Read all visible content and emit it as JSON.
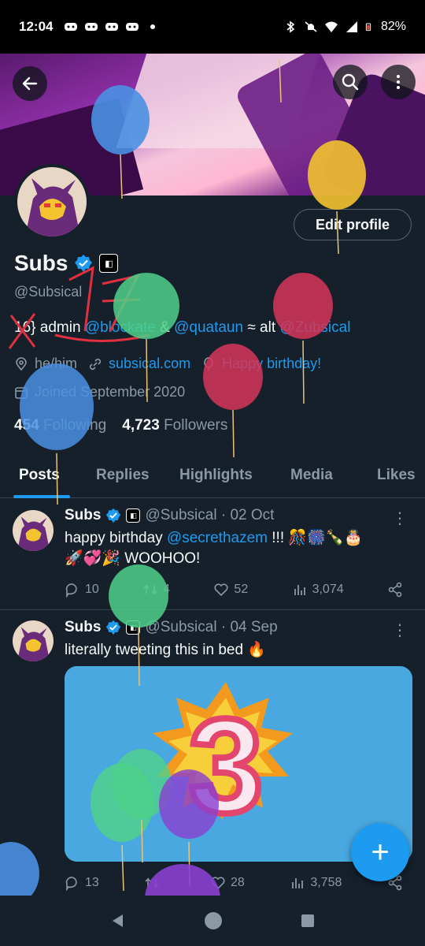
{
  "status_bar": {
    "time": "12:04",
    "battery": "82%",
    "left_icons": [
      "discord-icon",
      "discord-icon",
      "discord-icon",
      "discord-icon",
      "dot-icon"
    ],
    "right_icons": [
      "bluetooth-icon",
      "mute-icon",
      "wifi-icon",
      "signal-icon",
      "battery-icon"
    ]
  },
  "header": {
    "back_icon": "arrow-left-icon",
    "search_icon": "search-icon",
    "more_icon": "more-vertical-icon"
  },
  "profile": {
    "edit_profile_label": "Edit profile",
    "name": "Subs",
    "handle": "@Subsical",
    "bio": {
      "prefix": "16} ",
      "text1": "admin ",
      "link1": "@blockate",
      "text2": " & ",
      "link2": "@quataun",
      "text3": " ≈  alt ",
      "link3": "@Zubsical"
    },
    "pronouns": "he/him",
    "website": "subsical.com",
    "birthday": "Happy birthday!",
    "joined": "Joined September 2020",
    "following_count": "454",
    "following_label": "Following",
    "followers_count": "4,723",
    "followers_label": "Followers",
    "scribble_text": "17"
  },
  "tabs": [
    {
      "label": "Posts",
      "active": true
    },
    {
      "label": "Replies",
      "active": false
    },
    {
      "label": "Highlights",
      "active": false
    },
    {
      "label": "Media",
      "active": false
    },
    {
      "label": "Likes",
      "active": false
    }
  ],
  "posts": [
    {
      "name": "Subs",
      "handle": "@Subsical · 02 Oct",
      "text_prefix": "happy birthday ",
      "mention": "@secrethazem",
      "text_suffix": " !!! 🎊🎆🍾🎂",
      "text_line2": "🚀💞🎉 WOOHOO!",
      "replies": "10",
      "reposts": "4",
      "likes": "52",
      "views": "3,074"
    },
    {
      "name": "Subs",
      "handle": "@Subsical · 04 Sep",
      "text": "literally tweeting this in bed 🔥",
      "image_number": "3",
      "replies": "13",
      "reposts": "",
      "likes": "28",
      "views": "3,758"
    }
  ],
  "fab_label": "+",
  "colors": {
    "background": "#15202b",
    "accent": "#1d9bf0",
    "muted": "#8b98a5",
    "balloon_blue": "#4a90e2",
    "balloon_green": "#4fd18b",
    "balloon_red": "#d6365a",
    "balloon_yellow": "#f2c230",
    "balloon_purple": "#8a3fd1"
  }
}
